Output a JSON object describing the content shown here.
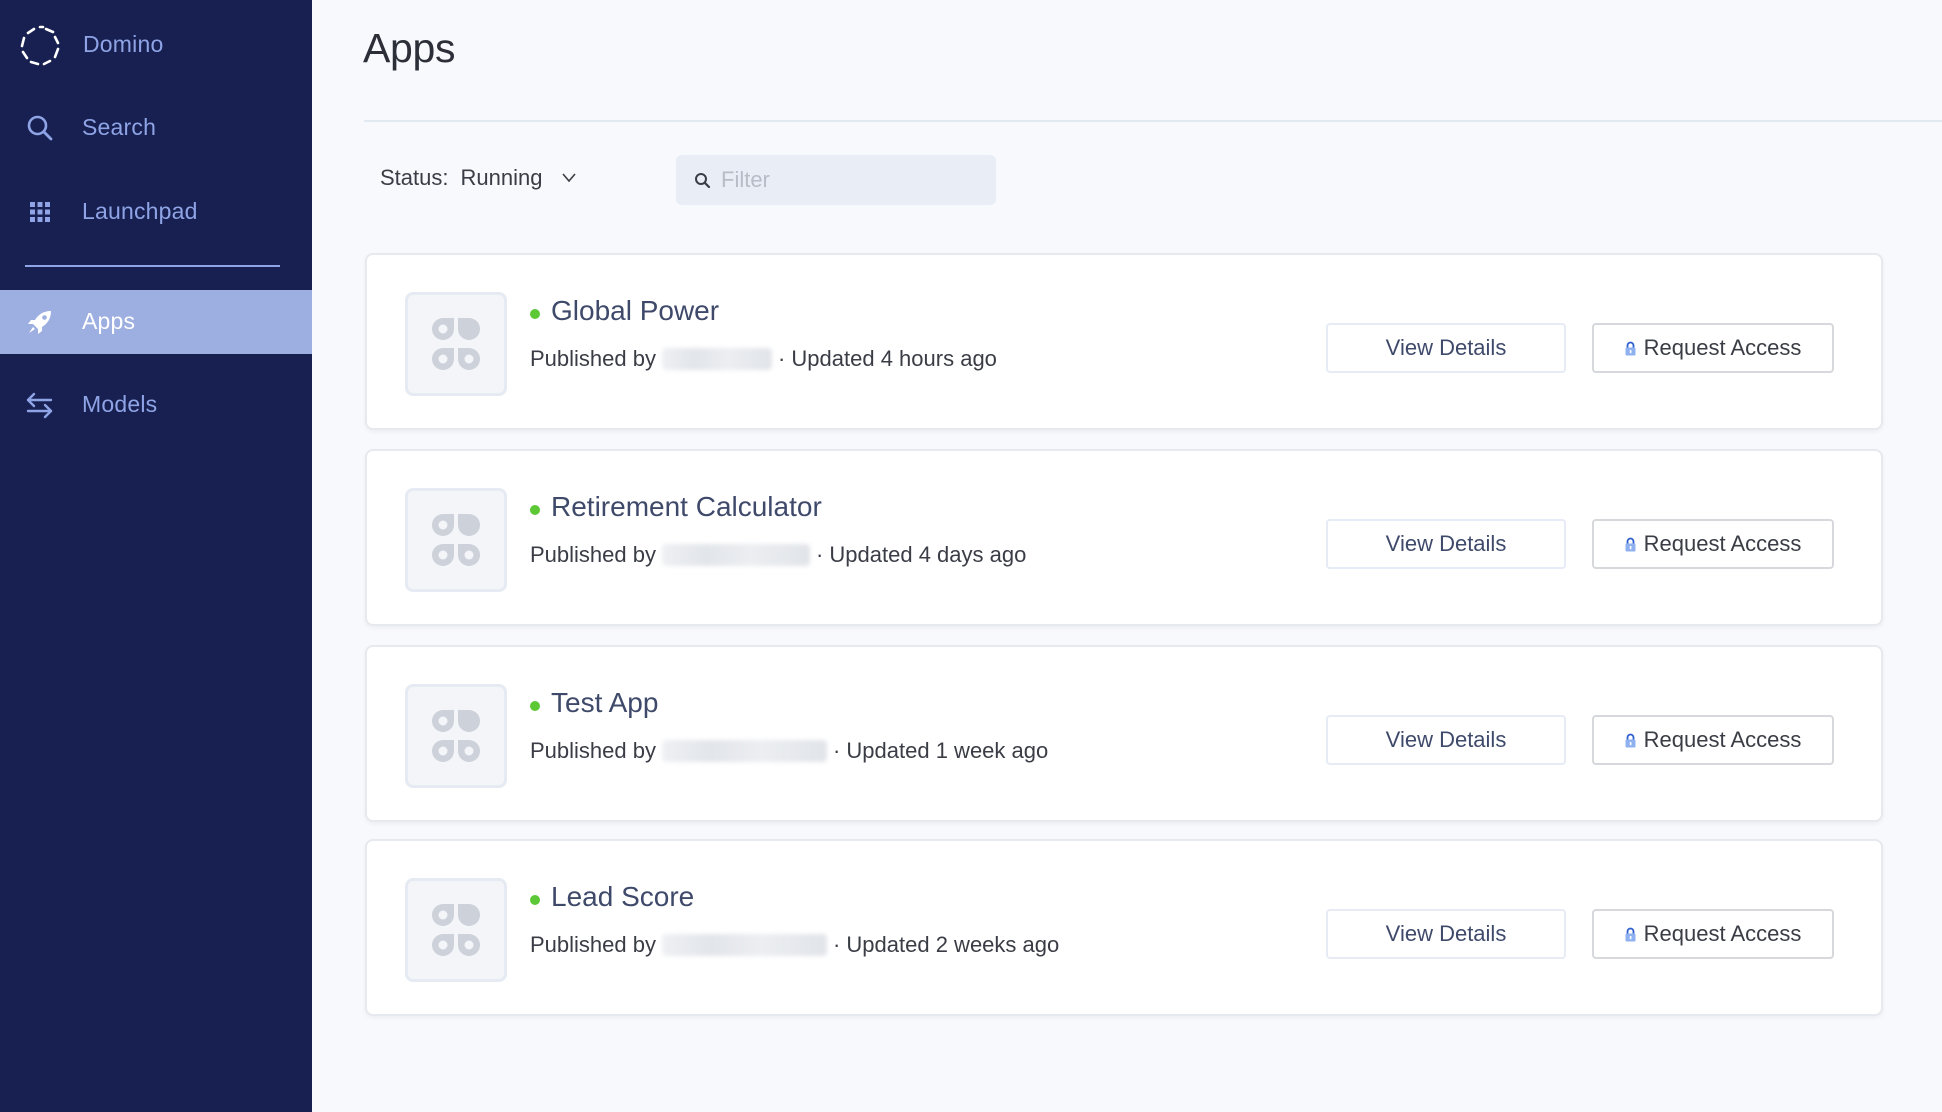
{
  "sidebar": {
    "brand": {
      "name": "Domino",
      "icon": "domino-logo-icon"
    },
    "items": [
      {
        "id": "search",
        "label": "Search",
        "icon": "search-icon",
        "active": false
      },
      {
        "id": "launchpad",
        "label": "Launchpad",
        "icon": "grid-icon",
        "active": false
      },
      {
        "id": "apps",
        "label": "Apps",
        "icon": "rocket-icon",
        "active": true
      },
      {
        "id": "models",
        "label": "Models",
        "icon": "swap-arrows-icon",
        "active": false
      }
    ]
  },
  "page": {
    "title": "Apps"
  },
  "filters": {
    "status_label": "Status:",
    "status_value": "Running",
    "filter_placeholder": "Filter",
    "filter_value": ""
  },
  "apps": [
    {
      "name": "Global Power",
      "status": "running",
      "published_prefix": "Published by",
      "publisher": "[redacted]",
      "updated": "· Updated 4 hours ago",
      "view_label": "View Details",
      "request_label": "Request Access"
    },
    {
      "name": "Retirement Calculator",
      "status": "running",
      "published_prefix": "Published by",
      "publisher": "[redacted]",
      "updated": "· Updated 4 days ago",
      "view_label": "View Details",
      "request_label": "Request Access"
    },
    {
      "name": "Test App",
      "status": "running",
      "published_prefix": "Published by",
      "publisher": "[redacted]",
      "updated": "· Updated 1 week ago",
      "view_label": "View Details",
      "request_label": "Request Access"
    },
    {
      "name": "Lead Score",
      "status": "running",
      "published_prefix": "Published by",
      "publisher": "[redacted]",
      "updated": "· Updated 2 weeks ago",
      "view_label": "View Details",
      "request_label": "Request Access"
    }
  ],
  "colors": {
    "sidebar_bg": "#172050",
    "sidebar_text": "#8fa4e6",
    "sidebar_active_bg": "#9daee1",
    "status_running": "#5cc836",
    "app_title": "#3f4a6b"
  }
}
